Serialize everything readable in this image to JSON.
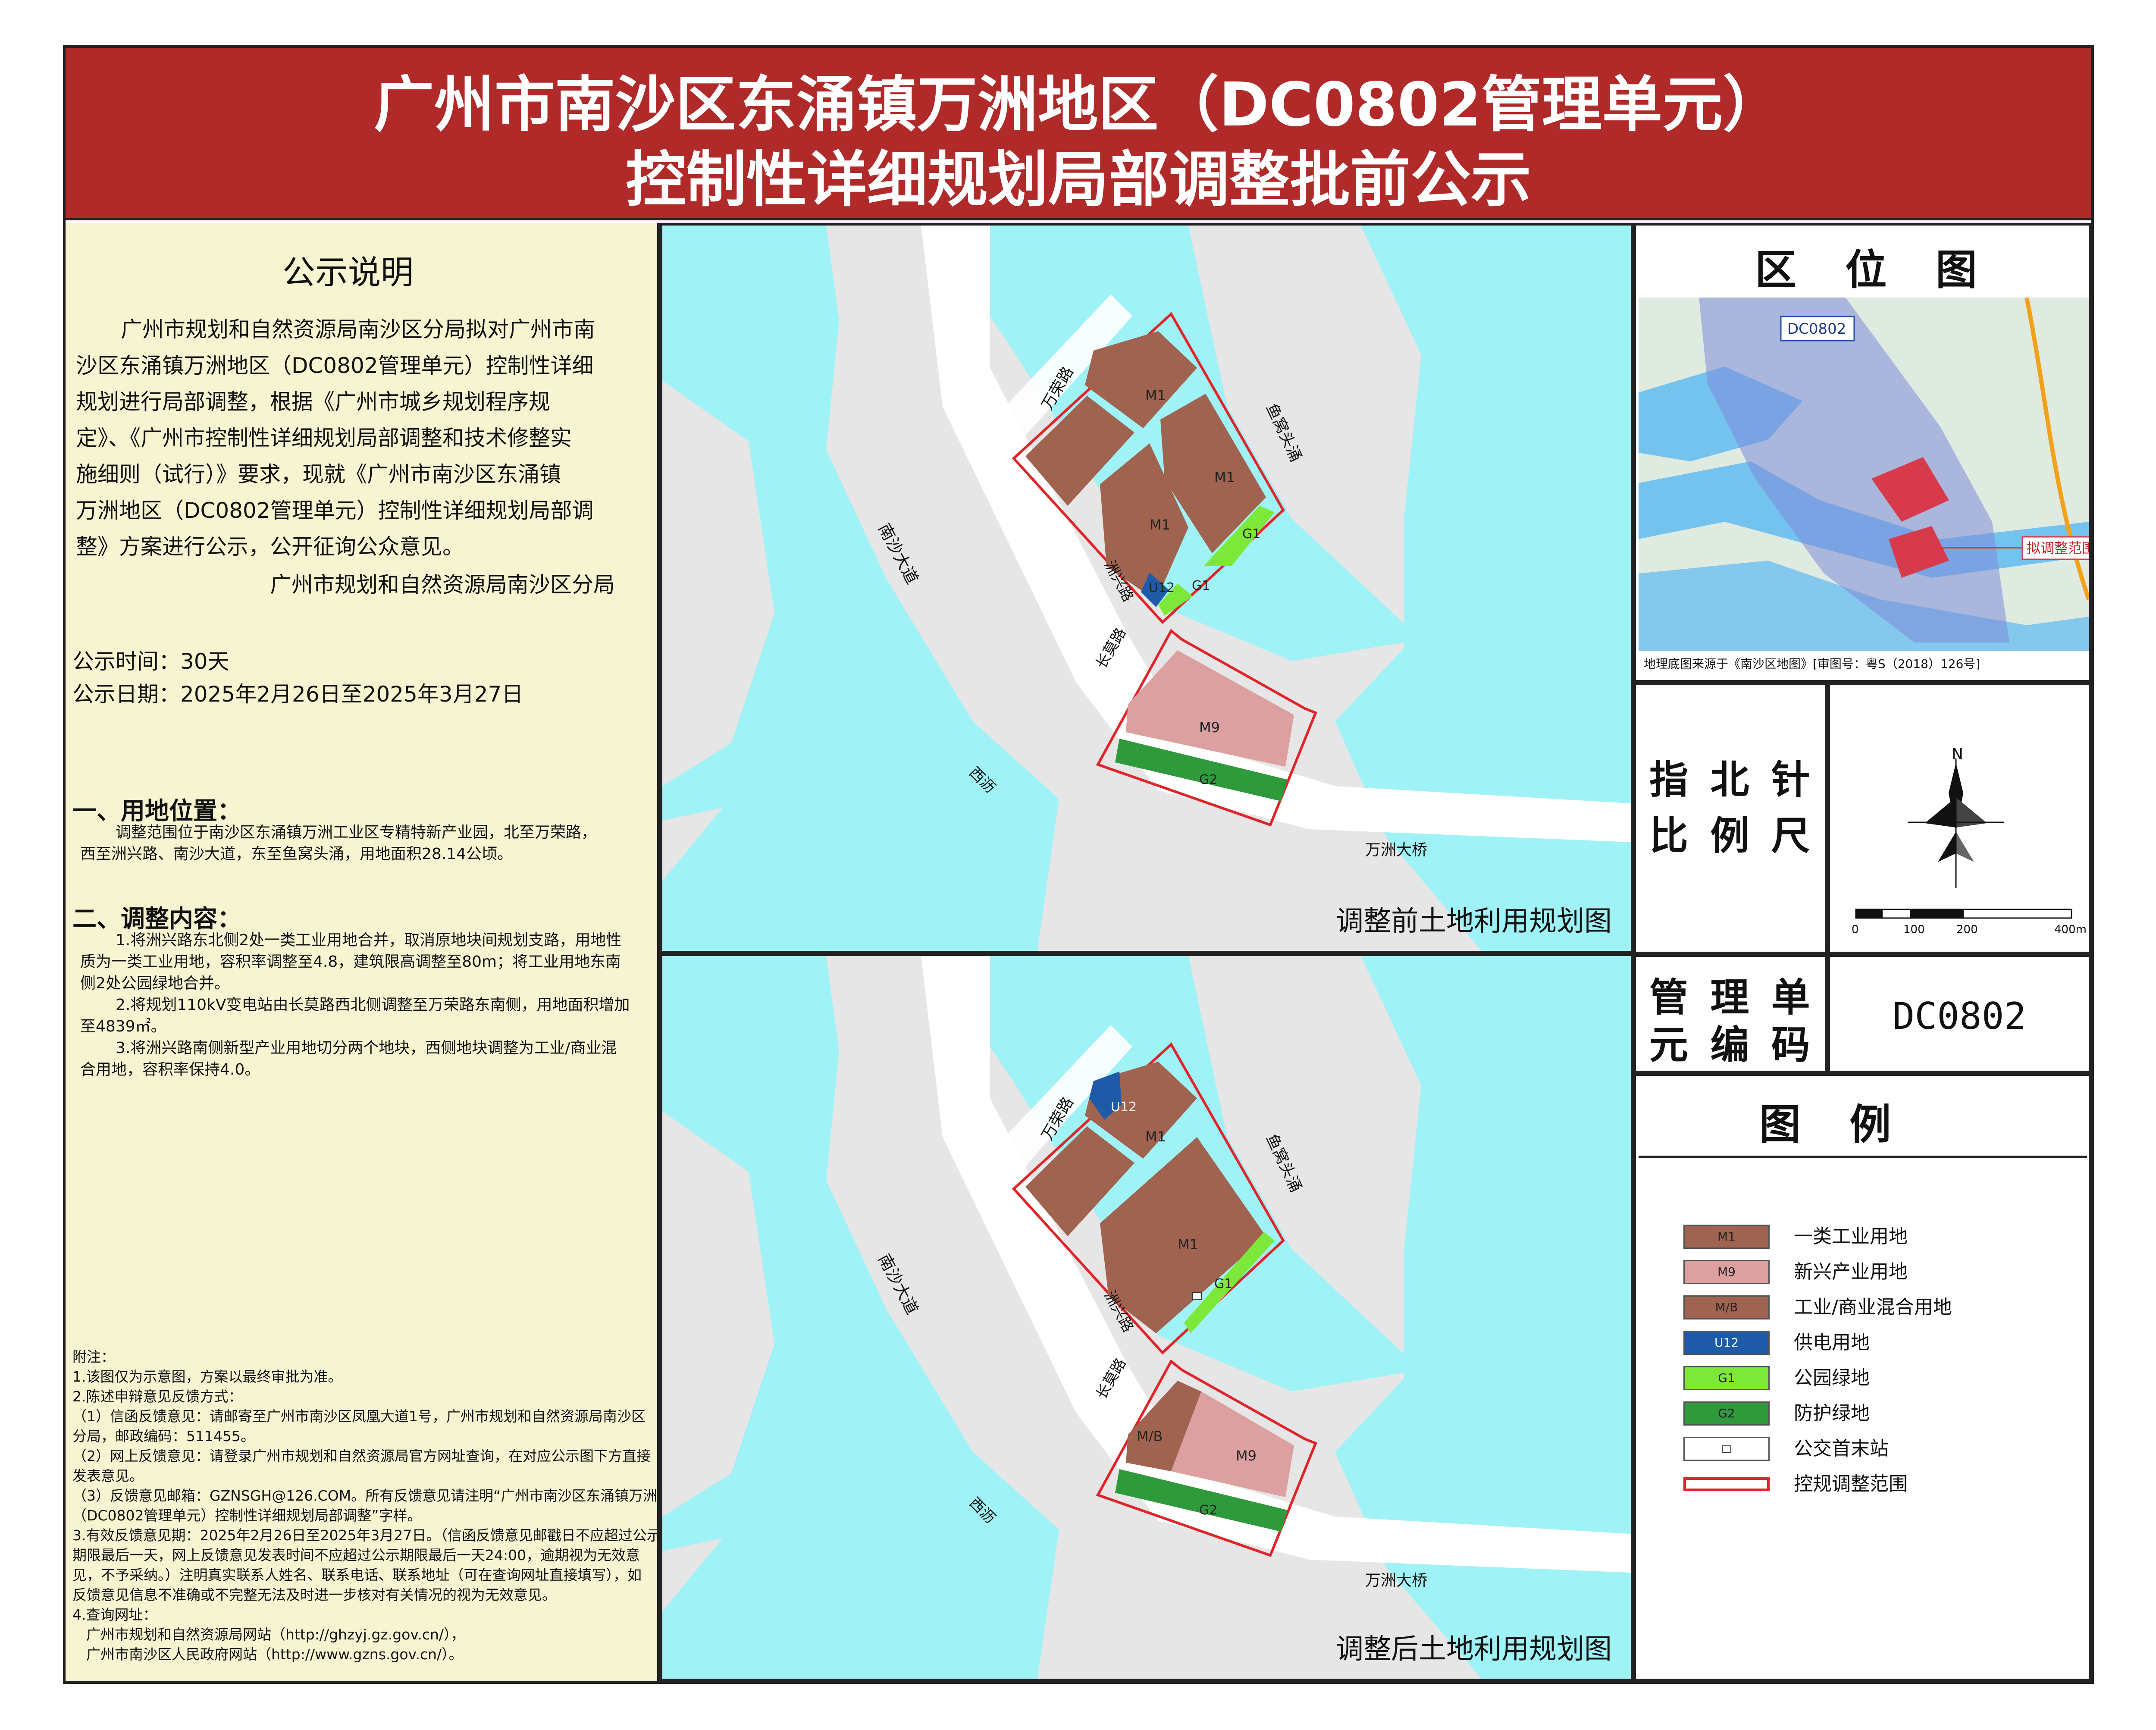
{
  "header": {
    "title_line1": "广州市南沙区东涌镇万洲地区（DC0802管理单元）",
    "title_line2": "控制性详细规划局部调整批前公示"
  },
  "notice": {
    "title": "公示说明",
    "body_lines": [
      "广州市规划和自然资源局南沙区分局拟对广州市南",
      "沙区东涌镇万洲地区（DC0802管理单元）控制性详细",
      "规划进行局部调整，根据《广州市城乡规划程序规",
      "定》、《广州市控制性详细规划局部调整和技术修整实",
      "施细则（试行）》要求，现就《广州市南沙区东涌镇",
      "万洲地区（DC0802管理单元）控制性详细规划局部调",
      "整》方案进行公示，公开征询公众意见。"
    ],
    "signature": "广州市规划和自然资源局南沙区分局",
    "period": "公示时间：30天",
    "dates": "公示日期：2025年2月26日至2025年3月27日"
  },
  "location": {
    "heading": "一、用地位置：",
    "lines": [
      "调整范围位于南沙区东涌镇万洲工业区专精特新产业园，北至万荣路，",
      "西至洲兴路、南沙大道，东至鱼窝头涌，用地面积28.14公顷。"
    ]
  },
  "adjustment": {
    "heading": "二、调整内容：",
    "lines": [
      "1.将洲兴路东北侧2处一类工业用地合并，取消原地块间规划支路，用地性",
      "质为一类工业用地，容积率调整至4.8，建筑限高调整至80m；将工业用地东南",
      "侧2处公园绿地合并。",
      "2.将规划110kV变电站由长莫路西北侧调整至万荣路东南侧，用地面积增加",
      "至4839㎡。",
      "3.将洲兴路南侧新型产业用地切分两个地块，西侧地块调整为工业/商业混",
      "合用地，容积率保持4.0。"
    ]
  },
  "notes": {
    "lines": [
      "附注：",
      "1.该图仅为示意图，方案以最终审批为准。",
      "2.陈述申辩意见反馈方式：",
      "（1）信函反馈意见：请邮寄至广州市南沙区凤凰大道1号，广州市规划和自然资源局南沙区",
      "分局，邮政编码：511455。",
      "（2）网上反馈意见：请登录广州市规划和自然资源局官方网址查询，在对应公示图下方直接",
      "发表意见。",
      "（3）反馈意见邮箱：GZNSGH@126.COM。所有反馈意见请注明“广州市南沙区东涌镇万洲地区",
      "（DC0802管理单元）控制性详细规划局部调整”字样。",
      "3.有效反馈意见期：2025年2月26日至2025年3月27日。（信函反馈意见邮戳日不应超过公示",
      "期限最后一天，网上反馈意见发表时间不应超过公示期限最后一天24:00，逾期视为无效意",
      "见，不予采纳。）注明真实联系人姓名、联系电话、联系地址（可在查询网址直接填写），如",
      "反馈意见信息不准确或不完整无法及时进一步核对有关情况的视为无效意见。",
      "4.查询网址：",
      "广州市规划和自然资源局网站（http://ghzyj.gz.gov.cn/），",
      "广州市南沙区人民政府网站（http://www.gzns.gov.cn/）。"
    ]
  },
  "map_before": {
    "title": "调整前土地利用规划图",
    "roads": {
      "wanrong": "万荣路",
      "yuwotou": "鱼窝头涌",
      "nansha": "南沙大道",
      "zhouxing": "洲兴路",
      "changmo": "长莫路",
      "xili": "西沥",
      "bridge": "万洲大桥"
    },
    "parcels": {
      "m1a": "M1",
      "m1b": "M1",
      "m1c": "M1",
      "u12": "U12",
      "g1a": "G1",
      "g1b": "G1",
      "m9": "M9",
      "g2": "G2"
    }
  },
  "map_after": {
    "title": "调整后土地利用规划图",
    "roads": {
      "wanrong": "万荣路",
      "yuwotou": "鱼窝头涌",
      "nansha": "南沙大道",
      "zhouxing": "洲兴路",
      "changmo": "长莫路",
      "xili": "西沥",
      "bridge": "万洲大桥"
    },
    "parcels": {
      "u12": "U12",
      "m1a": "M1",
      "m1b": "M1",
      "g1": "G1",
      "mb": "M/B",
      "m9": "M9",
      "g2": "G2"
    }
  },
  "location_map": {
    "title": "区 位 图",
    "unit_label": "DC0802",
    "range_label": "拟调整范围",
    "source": "地理底图来源于《南沙区地图》[审图号：粤S（2018）126号]"
  },
  "north_scale": {
    "title_line1": "指 北 针",
    "title_line2": "比 例 尺",
    "north": "N",
    "ticks": [
      "0",
      "100",
      "200",
      "400m"
    ]
  },
  "unit_code": {
    "label_line1": "管 理 单",
    "label_line2": "元 编 码",
    "value": "DC0802"
  },
  "legend": {
    "title": "图  例",
    "items": [
      {
        "code": "M1",
        "label": "一类工业用地",
        "color": "#a0634f"
      },
      {
        "code": "M9",
        "label": "新兴产业用地",
        "color": "#dca0a0"
      },
      {
        "code": "M/B",
        "label": "工业/商业混合用地",
        "color": "#a0634f"
      },
      {
        "code": "U12",
        "label": "供电用地",
        "color": "#1f5aa8"
      },
      {
        "code": "G1",
        "label": "公园绿地",
        "color": "#7ee83a"
      },
      {
        "code": "G2",
        "label": "防护绿地",
        "color": "#2f9a3c"
      },
      {
        "code": "",
        "label": "公交首末站",
        "color": "#ffffff"
      },
      {
        "code": "",
        "label": "控规调整范围",
        "color": "#e0242a"
      }
    ]
  }
}
